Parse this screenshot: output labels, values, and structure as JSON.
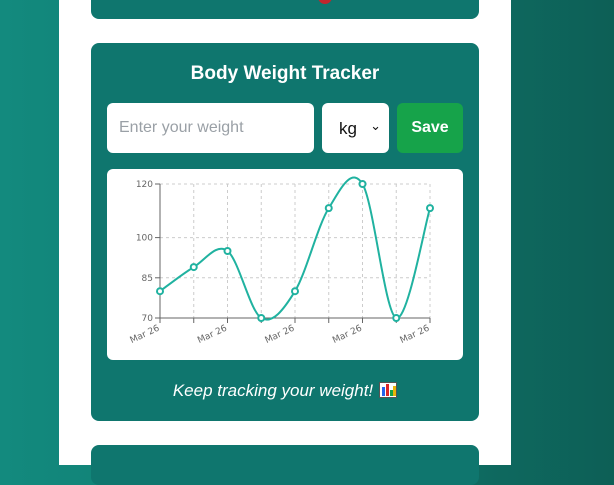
{
  "tracker": {
    "title": "Body Weight Tracker",
    "input_placeholder": "Enter your weight",
    "unit_selected": "kg",
    "save_label": "Save",
    "footer_text": "Keep tracking your weight!",
    "footer_icon": "bar-chart-emoji"
  },
  "colors": {
    "card": "#0f766e",
    "save_button": "#16a34a",
    "line": "#20b2a0"
  },
  "chart_data": {
    "type": "line",
    "x": [
      "Mar 26",
      "Mar 26",
      "Mar 26",
      "Mar 26",
      "Mar 26",
      "Mar 26",
      "Mar 26",
      "Mar 26",
      "Mar 26"
    ],
    "x_tick_labels": [
      "Mar 26",
      "Mar 26",
      "Mar 26",
      "Mar 26",
      "Mar 26"
    ],
    "series": [
      {
        "values": [
          80,
          89,
          95,
          70,
          80,
          111,
          120,
          70,
          111
        ]
      }
    ],
    "yticks": [
      70,
      85,
      100,
      120
    ],
    "ylim": [
      70,
      120
    ],
    "grid": true,
    "curve": "smooth"
  }
}
